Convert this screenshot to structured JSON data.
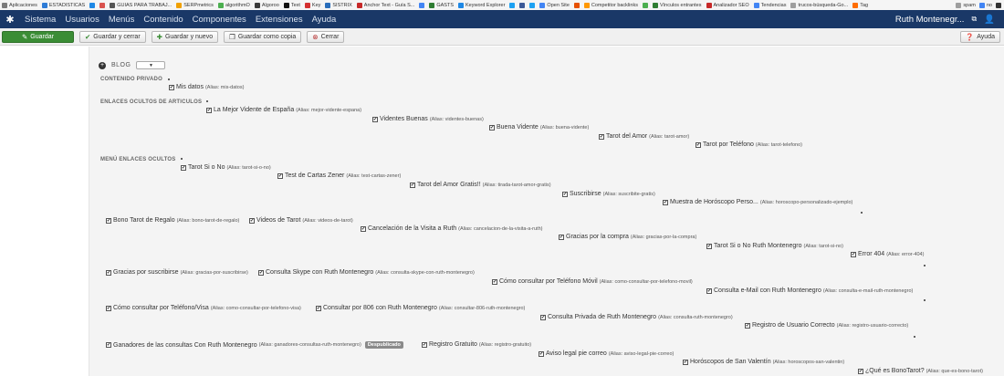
{
  "bookmarks": [
    {
      "label": "Aplicaciones",
      "color": "#7a7a7a"
    },
    {
      "label": "ESTADISTICAS",
      "color": "#2d7bd6"
    },
    {
      "label": "",
      "color": "#1e88e5"
    },
    {
      "label": "",
      "color": "#d9534f"
    },
    {
      "label": "GUIAS PARA TRABAJ...",
      "color": "#555555"
    },
    {
      "label": "SERPmetrics",
      "color": "#f0a000"
    },
    {
      "label": "algorithmO",
      "color": "#4caf50"
    },
    {
      "label": "Algoroo",
      "color": "#3b3b3b"
    },
    {
      "label": "Text",
      "color": "#111111"
    },
    {
      "label": "Key",
      "color": "#d32f2f"
    },
    {
      "label": "SISTRIX",
      "color": "#2a6ebb"
    },
    {
      "label": "Anchor Text - Guía S...",
      "color": "#c62828"
    },
    {
      "label": "",
      "color": "#4285f4"
    },
    {
      "label": "GASTS",
      "color": "#2e7d32"
    },
    {
      "label": "Keyword Explorer",
      "color": "#1e88e5"
    },
    {
      "label": "",
      "color": "#1da1f2"
    },
    {
      "label": "",
      "color": "#3b5998"
    },
    {
      "label": "",
      "color": "#1da1f2"
    },
    {
      "label": "Open Site",
      "color": "#4285f4"
    },
    {
      "label": "",
      "color": "#e65100"
    },
    {
      "label": "Competitor backlinks",
      "color": "#ff9800"
    },
    {
      "label": "",
      "color": "#4caf50"
    },
    {
      "label": "Vínculos entrantes",
      "color": "#2e7d32"
    },
    {
      "label": "Analizador SEO",
      "color": "#c62828"
    },
    {
      "label": "Tendencias",
      "color": "#4285f4"
    },
    {
      "label": "trucos-búsqueda-Go...",
      "color": "#9e9e9e"
    },
    {
      "label": "Tag",
      "color": "#ff6d00"
    }
  ],
  "bookmarks_right": [
    {
      "label": "spam",
      "color": "#9e9e9e"
    },
    {
      "label": "no",
      "color": "#4285f4"
    },
    {
      "label": "",
      "color": "#333333"
    }
  ],
  "nav": {
    "logo_icon": "joomla-icon",
    "items": [
      "Sistema",
      "Usuarios",
      "Menús",
      "Contenido",
      "Componentes",
      "Extensiones",
      "Ayuda"
    ],
    "user_name": "Ruth Montenegr...",
    "user_icon": "user-icon",
    "external_icon": "external-link-icon"
  },
  "toolbar": {
    "save": "Guardar",
    "save_close": "Guardar y cerrar",
    "save_new": "Guardar y nuevo",
    "save_copy": "Guardar como copia",
    "close": "Cerrar",
    "help": "Ayuda"
  },
  "blog": {
    "label": "BLOG",
    "sections": [
      "CONTENIDO PRIVADO",
      "ENLACES OCULTOS DE ARTICULOS",
      "MENÚ ENLACES OCULTOS"
    ],
    "unpublished_badge": "Despublicado",
    "items": [
      {
        "label": "Mis datos",
        "alias": "(Alias: mis-datos)"
      },
      {
        "label": "La Mejor Vidente de España",
        "alias": "(Alias: mejor-vidente-espana)"
      },
      {
        "label": "Videntes Buenas",
        "alias": "(Alias: videntes-buenas)"
      },
      {
        "label": "Buena Vidente",
        "alias": "(Alias: buena-vidente)"
      },
      {
        "label": "Tarot del Amor",
        "alias": "(Alias: tarot-amor)"
      },
      {
        "label": "Tarot por Teléfono",
        "alias": "(Alias: tarot-telefono)"
      },
      {
        "label": "Tarot Si o No",
        "alias": "(Alias: tarot-si-o-no)"
      },
      {
        "label": "Test de Cartas Zener",
        "alias": "(Alias: test-cartas-zener)"
      },
      {
        "label": "Tarot del Amor Gratis!!",
        "alias": "(Alias: tirada-tarot-amor-gratis)"
      },
      {
        "label": "Suscribirse",
        "alias": "(Alias: suscribite-gratis)"
      },
      {
        "label": "Muestra de Horóscopo Perso...",
        "alias": "(Alias: horoscopo-personalizado-ejemplo)"
      },
      {
        "label": "Bono Tarot de Regalo",
        "alias": "(Alias: bono-tarot-de-regalo)"
      },
      {
        "label": "Videos de Tarot",
        "alias": "(Alias: videos-de-tarot)"
      },
      {
        "label": "Cancelación de la Visita a Ruth",
        "alias": "(Alias: cancelacion-de-la-visita-a-ruth)"
      },
      {
        "label": "Gracias por la compra",
        "alias": "(Alias: gracias-por-la-compra)"
      },
      {
        "label": "Tarot Si o No Ruth Montenegro",
        "alias": "(Alias: tarot-si-no)"
      },
      {
        "label": "Error 404",
        "alias": "(Alias: error-404)"
      },
      {
        "label": "Gracias por suscribirse",
        "alias": "(Alias: gracias-por-suscribirse)"
      },
      {
        "label": "Consulta Skype con Ruth Montenegro",
        "alias": "(Alias: consulta-skype-con-ruth-montenegro)"
      },
      {
        "label": "Cómo consultar por Teléfono Móvil",
        "alias": "(Alias: como-consultar-por-telefono-movil)"
      },
      {
        "label": "Consulta e-Mail con Ruth Montenegro",
        "alias": "(Alias: consulta-e-mail-ruth-montenegro)"
      },
      {
        "label": "Cómo consultar por Teléfono/Visa",
        "alias": "(Alias: como-consultar-por-telefono-visa)"
      },
      {
        "label": "Consultar por 806 con Ruth Montenegro",
        "alias": "(Alias: consultar-806-ruth-montenegro)"
      },
      {
        "label": "Consulta Privada de Ruth Montenegro",
        "alias": "(Alias: consulta-ruth-montenegro)"
      },
      {
        "label": "Registro de Usuario Correcto",
        "alias": "(Alias: registro-usuario-correcto)"
      },
      {
        "label": "Ganadores de las consultas Con Ruth Montenegro",
        "alias": "(Alias: ganadores-consultas-ruth-montenegro)"
      },
      {
        "label": "Registro Gratuito",
        "alias": "(Alias: registro-gratuito)"
      },
      {
        "label": "Aviso legal pie correo",
        "alias": "(Alias: aviso-legal-pie-correo)"
      },
      {
        "label": "Horóscopos de San Valentín",
        "alias": "(Alias: horoscopos-san-valentin)"
      },
      {
        "label": "¿Qué es BonoTarot?",
        "alias": "(Alias: que-es-bono-tarot)"
      }
    ]
  }
}
